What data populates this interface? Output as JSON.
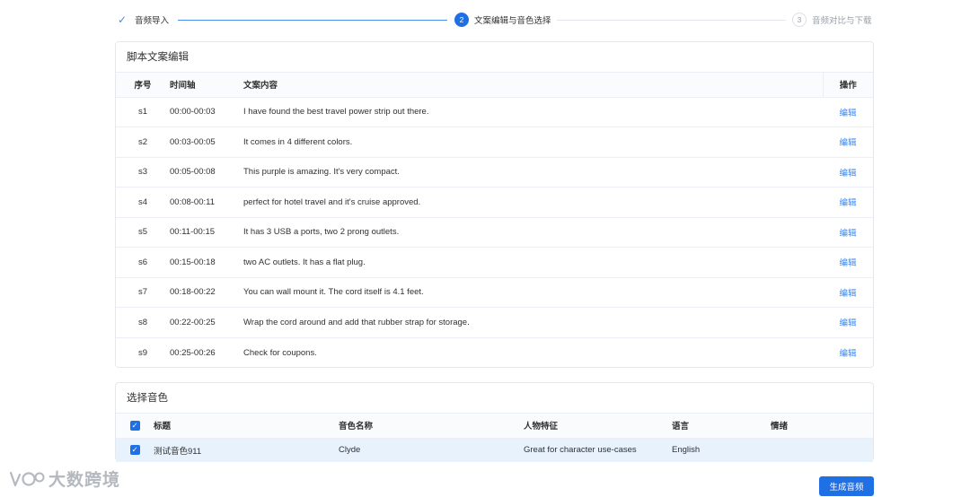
{
  "steps": [
    {
      "index": "1",
      "label": "音频导入",
      "status": "done"
    },
    {
      "index": "2",
      "label": "文案编辑与音色选择",
      "status": "active"
    },
    {
      "index": "3",
      "label": "音频对比与下载",
      "status": "pending"
    }
  ],
  "script_card": {
    "title": "脚本文案编辑",
    "headers": {
      "num": "序号",
      "time": "时间轴",
      "text": "文案内容",
      "op": "操作"
    },
    "edit_label": "编辑",
    "rows": [
      {
        "num": "s1",
        "time": "00:00-00:03",
        "text": "I have found the best travel power strip out there."
      },
      {
        "num": "s2",
        "time": "00:03-00:05",
        "text": "It comes in 4 different colors."
      },
      {
        "num": "s3",
        "time": "00:05-00:08",
        "text": "This purple is amazing. It's very compact."
      },
      {
        "num": "s4",
        "time": "00:08-00:11",
        "text": "perfect for hotel travel and it's cruise approved."
      },
      {
        "num": "s5",
        "time": "00:11-00:15",
        "text": "It has 3 USB a ports, two 2 prong outlets."
      },
      {
        "num": "s6",
        "time": "00:15-00:18",
        "text": "two AC outlets. It has a flat plug."
      },
      {
        "num": "s7",
        "time": "00:18-00:22",
        "text": "You can wall mount it. The cord itself is 4.1 feet."
      },
      {
        "num": "s8",
        "time": "00:22-00:25",
        "text": "Wrap the cord around and add that rubber strap for storage."
      },
      {
        "num": "s9",
        "time": "00:25-00:26",
        "text": "Check for coupons."
      }
    ]
  },
  "voice_card": {
    "title": "选择音色",
    "headers": {
      "title": "标题",
      "voice_name": "音色名称",
      "trait": "人物特征",
      "lang": "语言",
      "emotion": "情绪"
    },
    "rows": [
      {
        "title": "测试音色911",
        "voice_name": "Clyde",
        "trait": "Great for character use-cases",
        "lang": "English",
        "emotion": "",
        "checked": true
      }
    ]
  },
  "generate_button": "生成音频",
  "logo_text": "大数跨境",
  "colors": {
    "primary": "#1f6fe5",
    "link": "#3a86f0",
    "selected_row": "#e8f2fc"
  }
}
